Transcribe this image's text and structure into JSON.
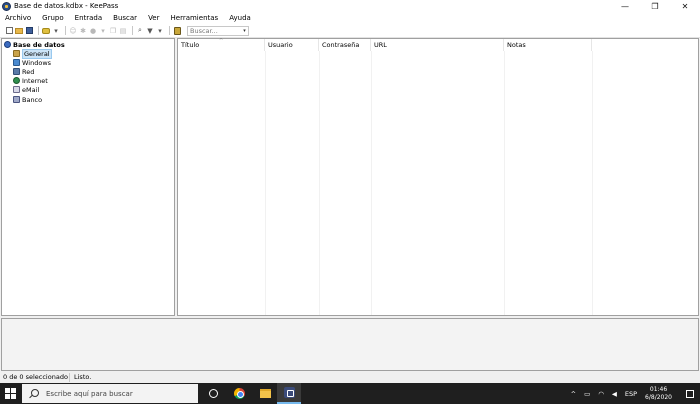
{
  "window": {
    "title": "Base de datos.kdbx - KeePass",
    "controls": {
      "minimize": "—",
      "restore": "❐",
      "close": "✕"
    }
  },
  "menu": [
    "Archivo",
    "Grupo",
    "Entrada",
    "Buscar",
    "Ver",
    "Herramientas",
    "Ayuda"
  ],
  "toolbar": {
    "search_placeholder": "Buscar...",
    "search_dropdown": "▾"
  },
  "tree": {
    "root": "Base de datos",
    "groups": [
      "General",
      "Windows",
      "Red",
      "Internet",
      "eMail",
      "Banco"
    ],
    "selected": "General"
  },
  "table": {
    "columns": [
      "Título",
      "Usuario",
      "Contraseña",
      "URL",
      "Notas"
    ],
    "sort_indicator": "^",
    "rows": []
  },
  "status": {
    "selection": "0 de 0 seleccionado",
    "message": "Listo."
  },
  "taskbar": {
    "search_placeholder": "Escribe aquí para buscar",
    "tray": {
      "arrow": "^",
      "language": "ESP",
      "time": "01:46",
      "date": "6/8/2020"
    }
  }
}
